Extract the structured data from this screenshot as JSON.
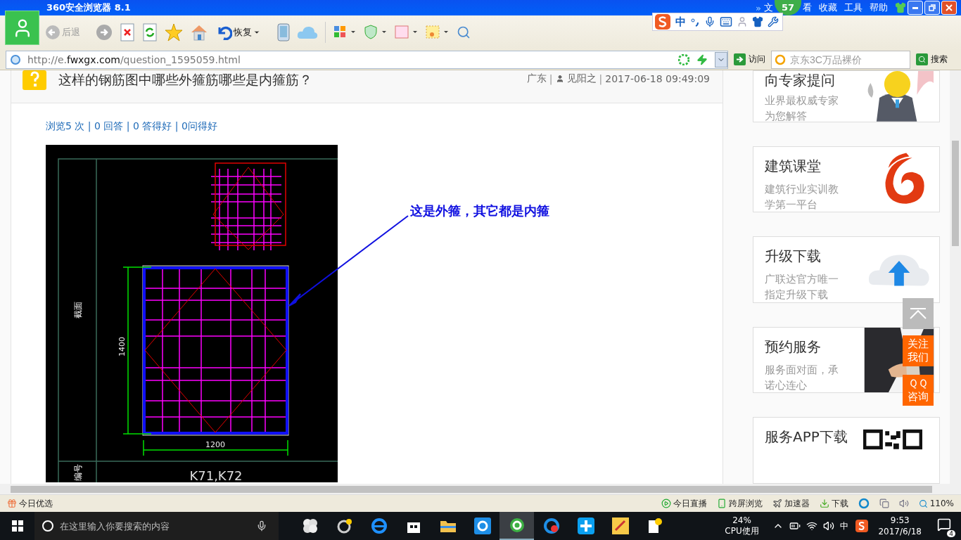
{
  "browser": {
    "title": "360安全浏览器 8.1",
    "badge": "57",
    "more": "»",
    "menu": [
      "文",
      "看",
      "收藏",
      "工具",
      "帮助"
    ],
    "back_button": {
      "label": "后退",
      "disabled": true
    },
    "restore_button": {
      "label": "恢复"
    },
    "ime": {
      "mode": "中"
    },
    "address": {
      "url": "http://e.**fwxgx.com**/question_1595059.html"
    },
    "go_button": "访问",
    "search": {
      "placeholder": "京东3C万品裸价",
      "button": "搜索"
    }
  },
  "question": {
    "title": "这样的钢筋图中哪些外箍筋哪些是内箍筋？",
    "meta": [
      {
        "kind": "text",
        "text": "广东"
      },
      {
        "kind": "sep",
        "text": "|"
      },
      {
        "kind": "author",
        "text": "见阳之"
      },
      {
        "kind": "sep",
        "text": "|"
      },
      {
        "kind": "text",
        "text": "2017-06-18 09:49:09"
      }
    ],
    "stats": "浏览5 次 | 0 回答 | 0 答得好 | 0问得好"
  },
  "drawing": {
    "section_label": "截面",
    "height_dim": "1400",
    "width_dim": "1200",
    "id_label": "编号",
    "id_value": "K71,K72",
    "annotation": "这是外箍，其它都是内箍"
  },
  "sidebar": {
    "cards": [
      {
        "kind": "mascot",
        "title": "向专家提问",
        "desc": "业界最权威专家为您解答"
      },
      {
        "kind": "logo",
        "title": "建筑课堂",
        "desc": "建筑行业实训教学第一平台"
      },
      {
        "kind": "cloud",
        "title": "升级下载",
        "desc": "广联达官方唯一指定升级下载"
      },
      {
        "title": "预约服务",
        "desc": "服务面对面，承诺心连心"
      },
      {
        "kind": "qr",
        "title": "服务APP下载"
      }
    ],
    "follow": "关注我们",
    "qq": "ＱＱ咨询"
  },
  "status_bar": {
    "left": "今日优选",
    "items": [
      {
        "kind": "live",
        "label": "今日直播"
      },
      {
        "kind": "screen",
        "label": "跨屏浏览"
      },
      {
        "kind": "speed",
        "label": "加速器"
      },
      {
        "kind": "download",
        "label": "下载"
      }
    ],
    "zoom": "110%"
  },
  "taskbar": {
    "search_placeholder": "在这里输入你要搜索的内容",
    "cpu": "24%",
    "cpu_label": "CPU使用",
    "ime": "中",
    "time": "9:53",
    "date": "2017/6/18",
    "notifications": "4"
  }
}
